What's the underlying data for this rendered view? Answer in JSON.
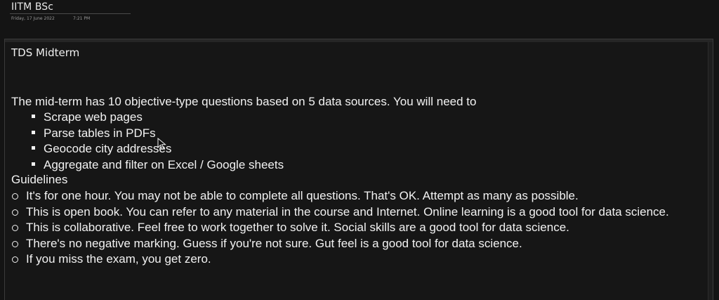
{
  "header": {
    "title": "IITM BSc",
    "date": "Friday, 17 June 2022",
    "time": "7:21 PM"
  },
  "note": {
    "heading": "TDS Midterm",
    "intro": "The mid-term has 10 objective-type questions based on 5 data sources. You will need to",
    "tasks": [
      "Scrape web pages",
      "Parse tables in PDFs",
      "Geocode city addresses",
      "Aggregate and filter on Excel / Google sheets"
    ],
    "guidelines_heading": "Guidelines",
    "guidelines": [
      "It's for one hour. You may not be able to complete all questions. That's OK. Attempt as many as possible.",
      "This is open book. You can refer to any material in the course and Internet. Online learning is a good tool for data science.",
      "This is collaborative. Feel free to work together to solve it. Social skills are a good tool for data science.",
      "There's no negative marking. Guess if you're not sure. Gut feel is a good tool for data science.",
      "If you miss the exam, you get zero."
    ]
  },
  "icons": {
    "cursor": "mouse-pointer-icon",
    "task_bullet": "square-bullet-icon",
    "guide_bullet": "circle-bullet-icon"
  },
  "colors": {
    "background": "#141414",
    "text": "#f2f2f2",
    "meta_text": "#9a9a9a"
  }
}
